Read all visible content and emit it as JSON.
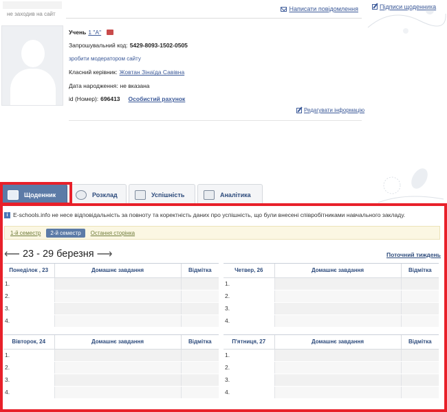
{
  "header": {
    "status": "не заходив на сайт",
    "write_message": "Написати повідомлення",
    "diary_signatures": "Підписи щоденника"
  },
  "profile": {
    "role": "Учень",
    "class_link": "1 \"А\"",
    "invite_label": "Запрошувальний код:",
    "invite_code": "5429-8093-1502-0505",
    "moderator_link": "зробити модератором сайту",
    "teacher_label": "Класний керівник:",
    "teacher_name": "Жовтан Зінаїда Савівна",
    "birth_label": "Дата народження:",
    "birth_value": "не вказана",
    "id_label": "id (Номер):",
    "id_value": "696413",
    "account_link": "Особистий рахунок",
    "edit_info": "Редагувати інформацію"
  },
  "tabs": [
    {
      "label": "Щоденник",
      "active": true
    },
    {
      "label": "Розклад",
      "active": false
    },
    {
      "label": "Успішність",
      "active": false
    },
    {
      "label": "Аналітика",
      "active": false
    }
  ],
  "notice": "E-schools.info не несе відповідальність за повноту та коректність даних про успішність, що були внесені співробітниками навчального закладу.",
  "semesters": {
    "first": "1-й семестр",
    "second": "2-й семестр",
    "last_page": "Остання сторінка"
  },
  "week": {
    "range": "23 - 29 березня",
    "current_week": "Поточний тиждень"
  },
  "columns": {
    "homework": "Домашнє завдання",
    "grade": "Відмітка"
  },
  "days": [
    {
      "name": "Понеділок , 23",
      "lessons": [
        "1.",
        "2.",
        "3.",
        "4."
      ]
    },
    {
      "name": "Четвер, 26",
      "lessons": [
        "1.",
        "2.",
        "3.",
        "4."
      ]
    },
    {
      "name": "Вівторок, 24",
      "lessons": [
        "1.",
        "2.",
        "3.",
        "4."
      ]
    },
    {
      "name": "П'ятниця, 27",
      "lessons": [
        "1.",
        "2.",
        "3.",
        "4."
      ]
    }
  ],
  "colors": {
    "accent": "#5c7ba7",
    "highlight": "#e8202a",
    "link": "#3b5998"
  }
}
